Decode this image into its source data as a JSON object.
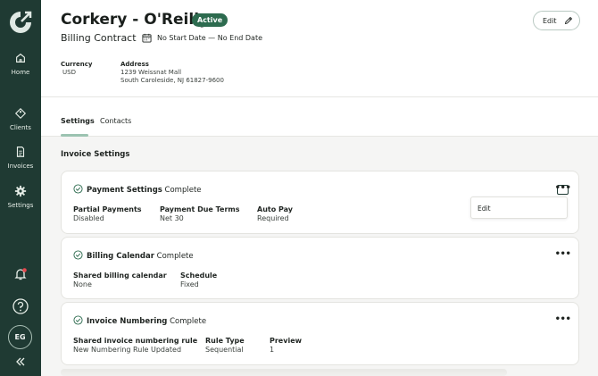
{
  "sidebar": {
    "items": [
      {
        "label": "Home",
        "icon": "home-icon"
      },
      {
        "label": "Clients",
        "icon": "tag-icon"
      },
      {
        "label": "Invoices",
        "icon": "document-icon"
      },
      {
        "label": "Settings",
        "icon": "gear-icon"
      }
    ],
    "avatar_initials": "EG"
  },
  "header": {
    "title": "Corkery - O'Reilly",
    "status": "Active",
    "subtitle": "Billing Contract",
    "date_range": "No Start Date — No End Date",
    "edit_label": "Edit",
    "currency_label": "Currency",
    "currency_value": "USD",
    "address_label": "Address",
    "address_line1": "1239 Weissnat Mall",
    "address_line2": "South Caroleside, NJ 61827-9600"
  },
  "tabs": [
    {
      "label": "Settings",
      "active": true
    },
    {
      "label": "Contacts",
      "active": false
    }
  ],
  "section_heading": "Invoice Settings",
  "cards": [
    {
      "title": "Payment Settings",
      "status": "Complete",
      "fields": [
        {
          "label": "Partial Payments",
          "value": "Disabled"
        },
        {
          "label": "Payment Due Terms",
          "value": "Net 30"
        },
        {
          "label": "Auto Pay",
          "value": "Required"
        }
      ]
    },
    {
      "title": "Billing Calendar",
      "status": "Complete",
      "fields": [
        {
          "label": "Shared billing calendar",
          "value": "None"
        },
        {
          "label": "Schedule",
          "value": "Fixed"
        }
      ]
    },
    {
      "title": "Invoice Numbering",
      "status": "Complete",
      "fields": [
        {
          "label": "Shared invoice numbering rule",
          "value": "New Numbering Rule Updated"
        },
        {
          "label": "Rule Type",
          "value": "Sequential"
        },
        {
          "label": "Preview",
          "value": "1"
        }
      ]
    }
  ],
  "dropdown": {
    "items": [
      "Edit"
    ]
  },
  "colors": {
    "sidebar_bg": "#1f3a33",
    "accent": "#2d6b4f",
    "notification_dot": "#e5484d"
  }
}
